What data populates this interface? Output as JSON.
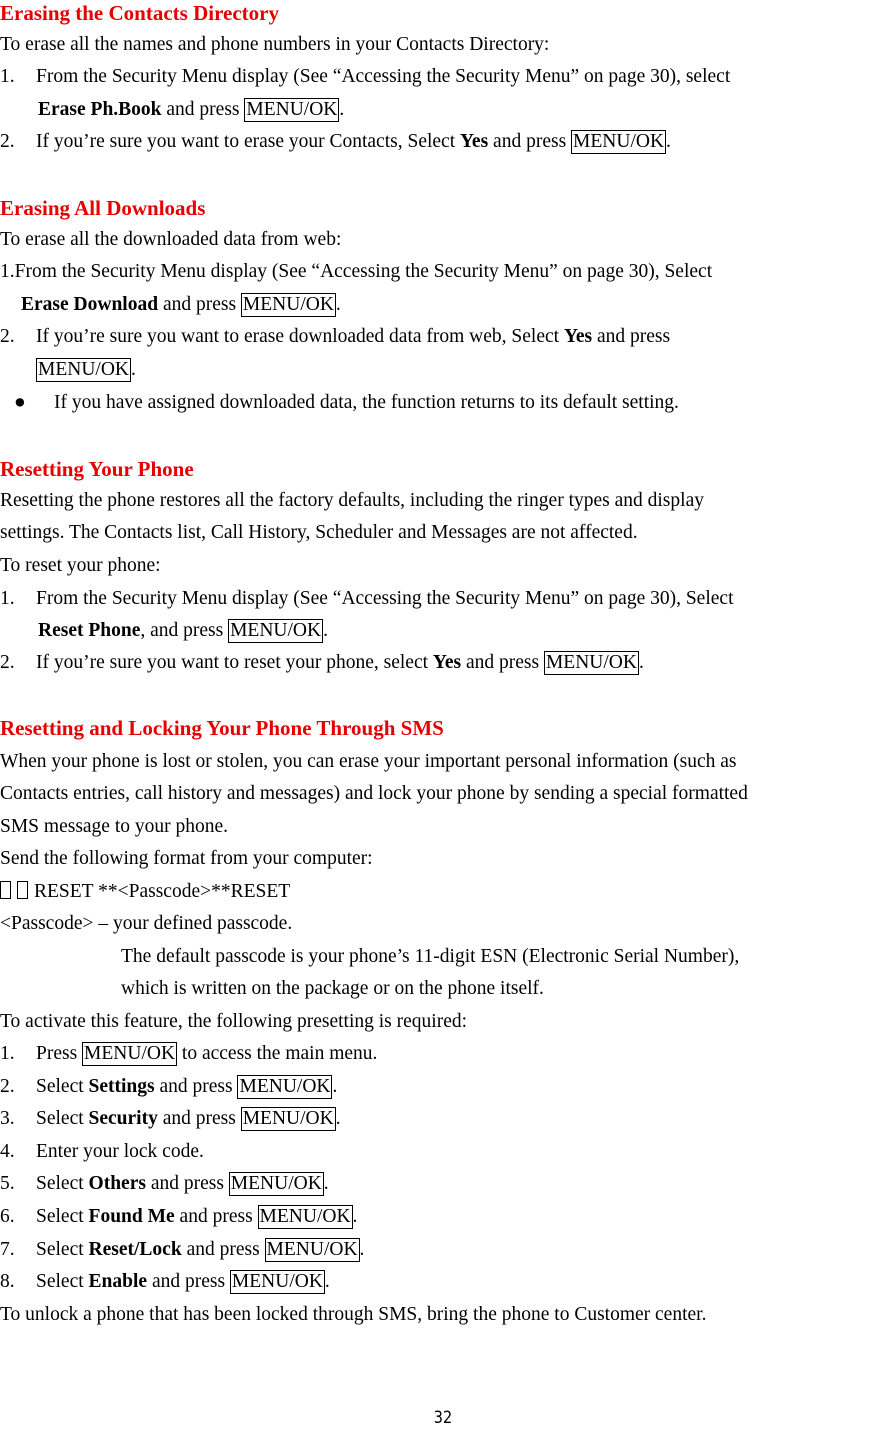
{
  "sections": {
    "contacts": {
      "title": "Erasing the Contacts Directory",
      "intro": "To erase all the names and phone numbers in your Contacts Directory:",
      "step1_num": "1.",
      "step1_text": "From the Security Menu display (See “Accessing the Security Menu” on page 30), select",
      "step1_item": "Erase Ph.Book",
      "step1_and": " and press ",
      "key": "MENU/OK",
      "step2_num": "2.",
      "step2_text": "If you’re sure you want to erase your Contacts, Select ",
      "step2_item": "Yes",
      "step2_and": " and press "
    },
    "downloads": {
      "title": "Erasing All Downloads",
      "intro": "To erase all the downloaded data from web:",
      "step1_text": "1.From the Security Menu display (See “Accessing the Security Menu” on page 30), Select",
      "step1_item": "Erase Download",
      "step1_and": " and press ",
      "step2_num": "2.",
      "step2_text": "If you’re sure you want to erase downloaded data from web, Select ",
      "step2_item": "Yes",
      "step2_and": " and press",
      "note": "If you have assigned downloaded data, the function returns to its default setting."
    },
    "reset": {
      "title": "Resetting Your Phone",
      "p1": "Resetting the phone restores all the factory defaults, including the ringer types and display",
      "p2": "settings. The Contacts list, Call History, Scheduler and Messages are not affected.",
      "p3": "To reset your phone:",
      "step1_num": "1.",
      "step1_text": "From the Security Menu display (See “Accessing the Security Menu” on page 30), Select",
      "step1_item": "Reset Phone",
      "step1_and": ", and press ",
      "step2_num": "2.",
      "step2_text": "If you’re sure you want to reset your phone, select ",
      "step2_item": "Yes",
      "step2_and": " and press "
    },
    "sms": {
      "title": "Resetting and Locking Your Phone Through SMS",
      "p1": "When your phone is lost or stolen, you can erase your important personal information (such as",
      "p2": "Contacts entries, call history and messages) and lock your phone by sending a special formatted",
      "p3": "SMS message to your phone.",
      "p4": "Send the following format from your computer:",
      "format": "RESET **<Passcode>**RESET",
      "passcode_def": "<Passcode> – your defined passcode.",
      "default1": "The default passcode is your phone’s 11-digit ESN (Electronic Serial Number),",
      "default2": "which is written on the package or on the phone itself.",
      "activate": "To activate this feature, the following presetting is required:",
      "steps": [
        {
          "num": "1.",
          "pre": "Press ",
          "item": "",
          "mid": "",
          "key": "MENU/OK",
          "post": " to access the main menu."
        },
        {
          "num": "2.",
          "pre": "Select ",
          "item": "Settings",
          "mid": " and press ",
          "key": "MENU/OK",
          "post": "."
        },
        {
          "num": "3.",
          "pre": "Select ",
          "item": "Security",
          "mid": " and press ",
          "key": "MENU/OK",
          "post": "."
        },
        {
          "num": "4.",
          "pre": "Enter your lock code.",
          "item": "",
          "mid": "",
          "key": "",
          "post": ""
        },
        {
          "num": "5.",
          "pre": "Select ",
          "item": "Others",
          "mid": " and press ",
          "key": "MENU/OK",
          "post": "."
        },
        {
          "num": "6.",
          "pre": "Select ",
          "item": "Found Me",
          "mid": " and press ",
          "key": "MENU/OK",
          "post": "."
        },
        {
          "num": "7.",
          "pre": "Select ",
          "item": "Reset/Lock",
          "mid": " and press ",
          "key": "MENU/OK",
          "post": "."
        },
        {
          "num": "8.",
          "pre": "Select ",
          "item": "Enable",
          "mid": " and press ",
          "key": "MENU/OK",
          "post": "."
        }
      ],
      "unlock": "To unlock a phone that has been locked through SMS, bring the phone to Customer center."
    }
  },
  "punct": ".",
  "page_number": "32"
}
